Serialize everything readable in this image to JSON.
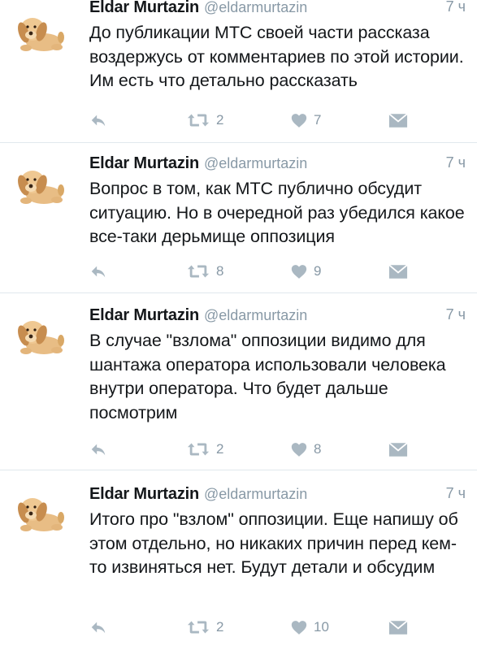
{
  "tweets": [
    {
      "name": "Eldar Murtazin",
      "handle": "@eldarmurtazin",
      "time": "7 ч",
      "text": "До публикации МТС своей части рассказа воздержусь от комментариев по этой истории. Им есть что детально рассказать",
      "retweets": "2",
      "likes": "7"
    },
    {
      "name": "Eldar Murtazin",
      "handle": "@eldarmurtazin",
      "time": "7 ч",
      "text": "Вопрос в том, как МТС публично обсудит ситуацию. Но в очередной раз убедился какое все-таки дерьмище оппозиция",
      "retweets": "8",
      "likes": "9"
    },
    {
      "name": "Eldar Murtazin",
      "handle": "@eldarmurtazin",
      "time": "7 ч",
      "text": "В случае \"взлома\" оппозиции видимо для шантажа оператора использовали человека внутри оператора. Что будет дальше посмотрим",
      "retweets": "2",
      "likes": "8"
    },
    {
      "name": "Eldar Murtazin",
      "handle": "@eldarmurtazin",
      "time": "7 ч",
      "text": "Итого про \"взлом\" оппозиции. Еще напишу об этом отдельно, но никаких причин перед кем-то извиняться нет. Будут детали и обсудим",
      "retweets": "2",
      "likes": "10"
    }
  ],
  "icons": {
    "reply": "reply-icon",
    "retweet": "retweet-icon",
    "like": "heart-icon",
    "dm": "envelope-icon",
    "avatar": "plush-dog-avatar"
  },
  "colors": {
    "text": "#14171a",
    "muted": "#8899a6",
    "divider": "#e1e8ed",
    "avatar": "#d9a866"
  }
}
